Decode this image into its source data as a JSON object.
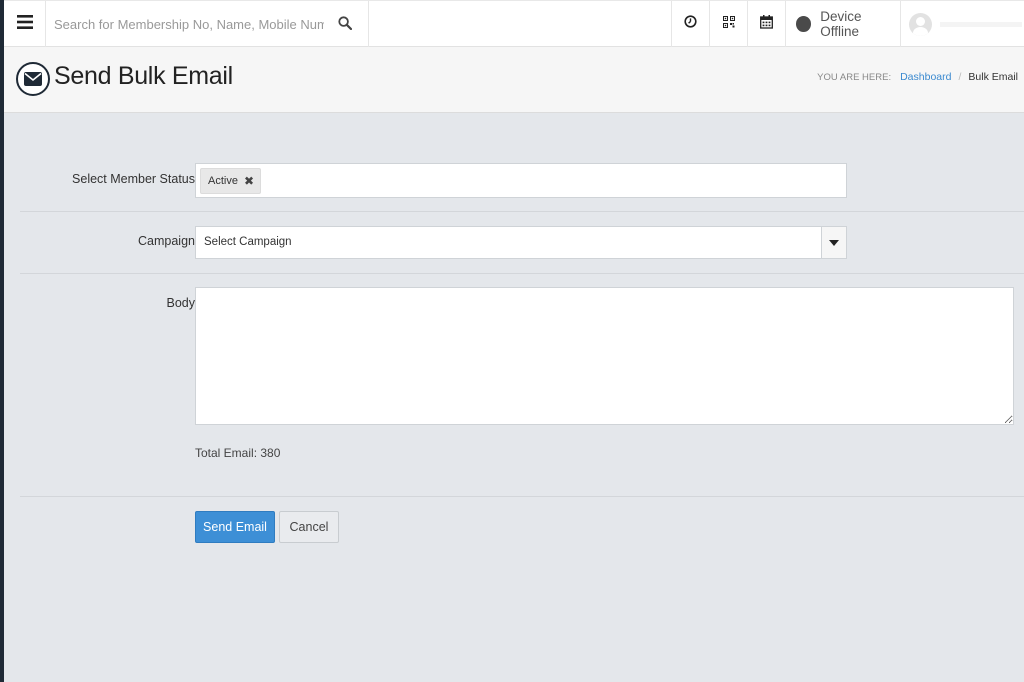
{
  "header": {
    "search_placeholder": "Search for Membership No, Name, Mobile Number",
    "device_status": "Device Offline",
    "icons": [
      "menu-icon",
      "search-icon",
      "clock-icon",
      "qr-code-icon",
      "calendar-icon"
    ]
  },
  "page": {
    "title": "Send Bulk Email",
    "icon": "envelope-icon"
  },
  "breadcrumb": {
    "prefix": "YOU ARE HERE:",
    "link": "Dashboard",
    "separator": "/",
    "current": "Bulk Email"
  },
  "form": {
    "member_status": {
      "label": "Select Member Status",
      "tags": [
        "Active"
      ],
      "remove_symbol": "✖"
    },
    "campaign": {
      "label": "Campaign",
      "selected": "Select Campaign"
    },
    "body": {
      "label": "Body",
      "value": ""
    },
    "total_email": "Total Email: 380",
    "send_button": "Send Email",
    "cancel_button": "Cancel"
  },
  "colors": {
    "primary": "#3d8fd6",
    "background": "#e4e7eb",
    "sidebar_edge": "#1f2a36",
    "link": "#3b8ad0"
  }
}
